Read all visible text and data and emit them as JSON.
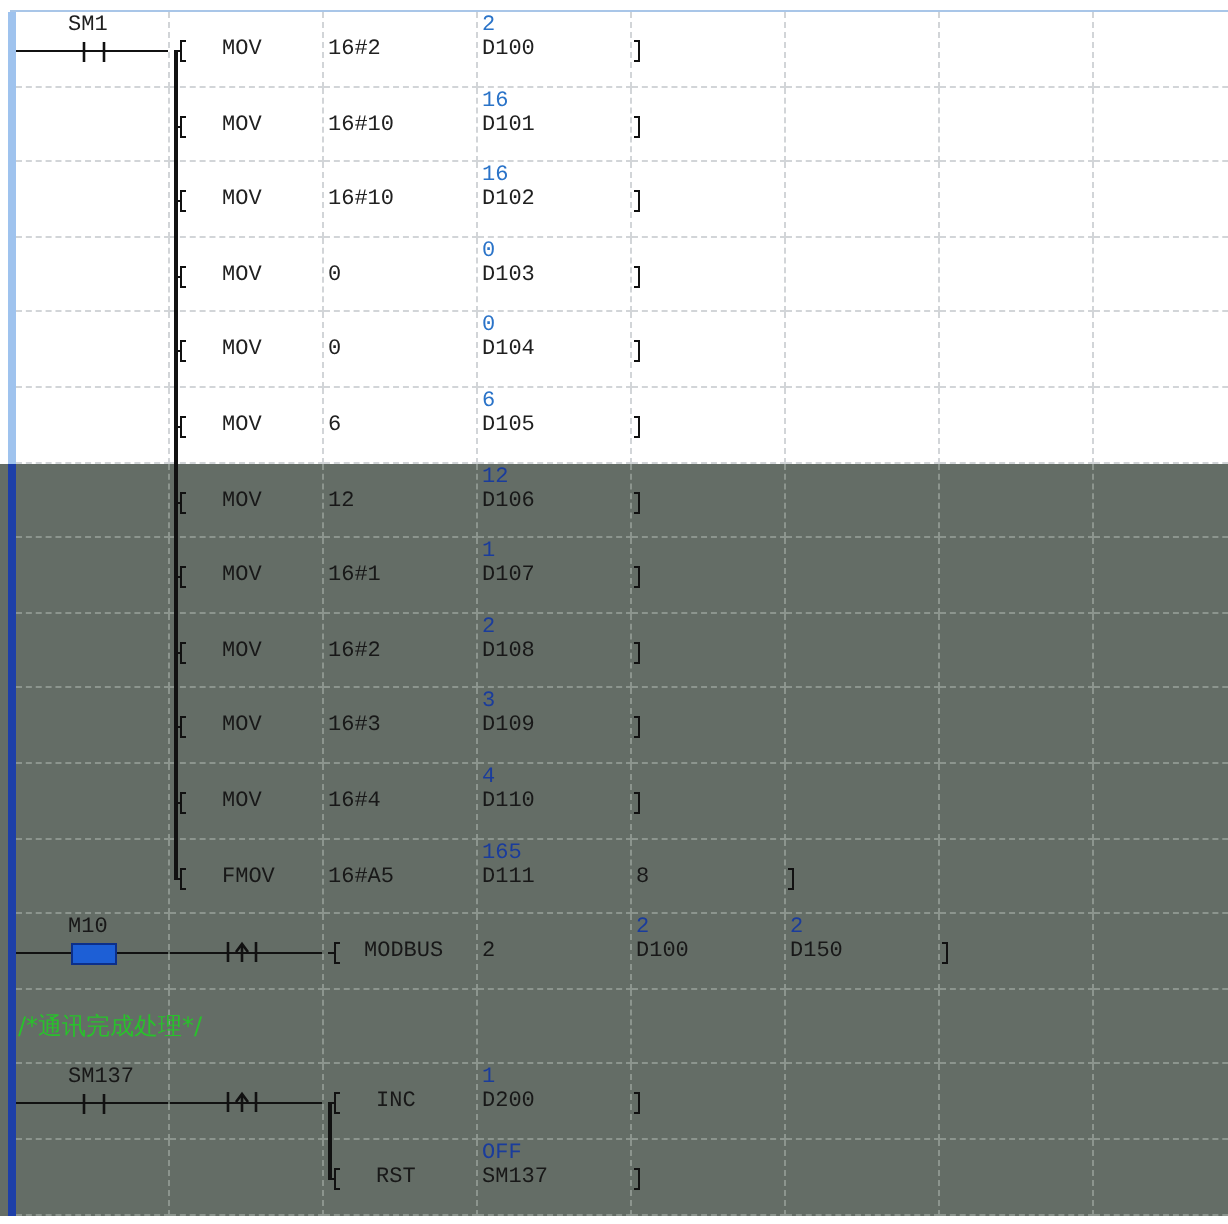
{
  "rungs": [
    {
      "kind": "rung",
      "contact": {
        "label": "SM1",
        "on": false
      },
      "instructions": [
        {
          "op": "MOV",
          "shaded": false,
          "args": [
            {
              "text": "16#2"
            },
            {
              "text": "D100",
              "value": "2"
            }
          ]
        },
        {
          "op": "MOV",
          "shaded": false,
          "args": [
            {
              "text": "16#10"
            },
            {
              "text": "D101",
              "value": "16"
            }
          ]
        },
        {
          "op": "MOV",
          "shaded": false,
          "args": [
            {
              "text": "16#10"
            },
            {
              "text": "D102",
              "value": "16"
            }
          ]
        },
        {
          "op": "MOV",
          "shaded": false,
          "args": [
            {
              "text": "0"
            },
            {
              "text": "D103",
              "value": "0"
            }
          ]
        },
        {
          "op": "MOV",
          "shaded": false,
          "args": [
            {
              "text": "0"
            },
            {
              "text": "D104",
              "value": "0"
            }
          ]
        },
        {
          "op": "MOV",
          "shaded": false,
          "args": [
            {
              "text": "6"
            },
            {
              "text": "D105",
              "value": "6"
            }
          ]
        },
        {
          "op": "MOV",
          "shaded": true,
          "args": [
            {
              "text": "12"
            },
            {
              "text": "D106",
              "value": "12"
            }
          ]
        },
        {
          "op": "MOV",
          "shaded": true,
          "args": [
            {
              "text": "16#1"
            },
            {
              "text": "D107",
              "value": "1"
            }
          ]
        },
        {
          "op": "MOV",
          "shaded": true,
          "args": [
            {
              "text": "16#2"
            },
            {
              "text": "D108",
              "value": "2"
            }
          ]
        },
        {
          "op": "MOV",
          "shaded": true,
          "args": [
            {
              "text": "16#3"
            },
            {
              "text": "D109",
              "value": "3"
            }
          ]
        },
        {
          "op": "MOV",
          "shaded": true,
          "args": [
            {
              "text": "16#4"
            },
            {
              "text": "D110",
              "value": "4"
            }
          ]
        },
        {
          "op": "FMOV",
          "shaded": true,
          "args": [
            {
              "text": "16#A5"
            },
            {
              "text": "D111",
              "value": "165"
            },
            {
              "text": "8"
            }
          ]
        }
      ]
    },
    {
      "kind": "rung",
      "contact": {
        "label": "M10",
        "on": true
      },
      "edge": true,
      "instructions": [
        {
          "op": "MODBUS",
          "shaded": true,
          "args": [
            {
              "text": "2"
            },
            {
              "text": "D100",
              "value": "2"
            },
            {
              "text": "D150",
              "value": "2"
            }
          ]
        }
      ]
    },
    {
      "kind": "comment",
      "text": "/*通讯完成处理*/",
      "shaded": true
    },
    {
      "kind": "rung",
      "contact": {
        "label": "SM137",
        "on": false
      },
      "edge": true,
      "instructions": [
        {
          "op": "INC",
          "shaded": true,
          "args": [
            {
              "text": "D200",
              "value": "1"
            }
          ]
        },
        {
          "op": "RST",
          "shaded": true,
          "args": [
            {
              "text": "SM137",
              "value": "OFF"
            }
          ]
        }
      ]
    }
  ]
}
